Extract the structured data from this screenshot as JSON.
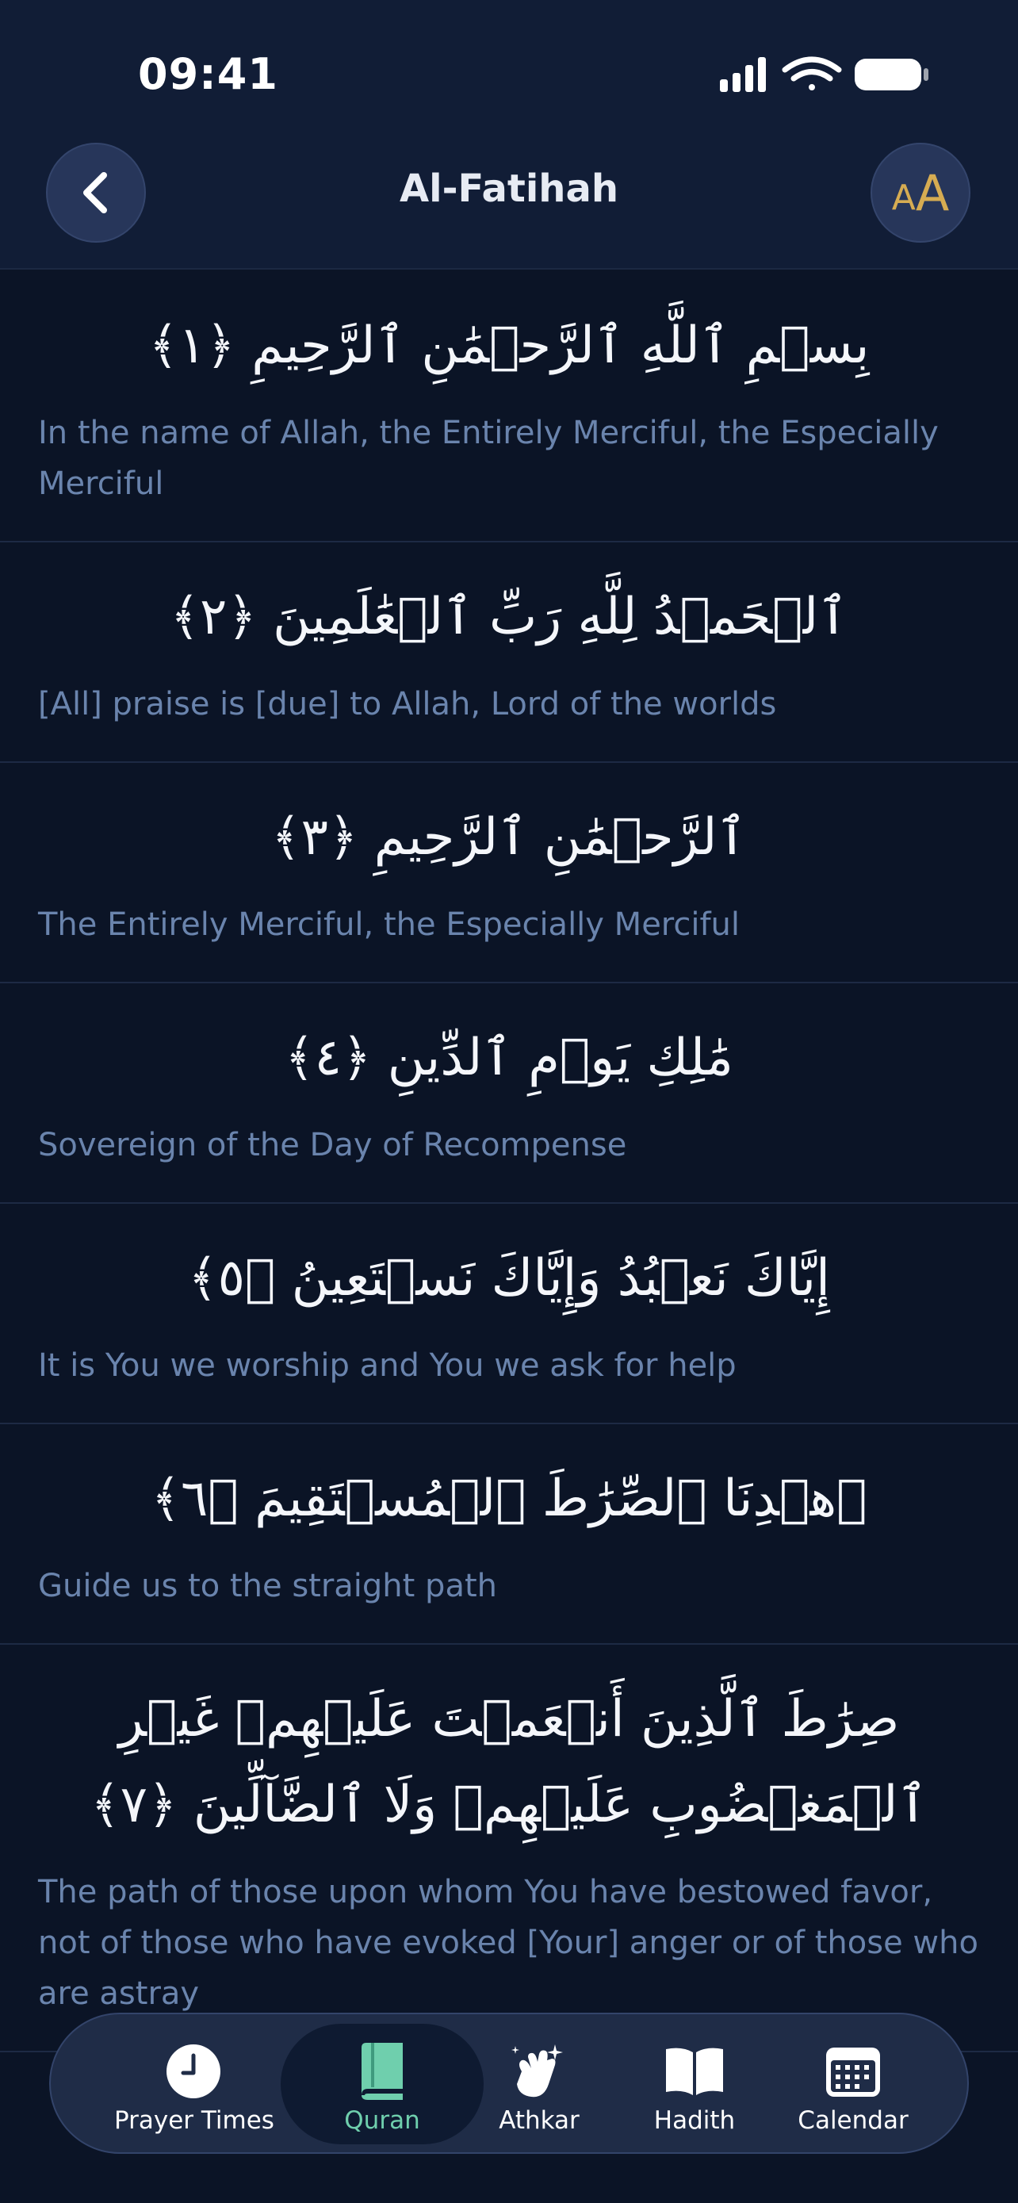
{
  "status_bar": {
    "time": "09:41"
  },
  "header": {
    "title": "Al-Fatihah",
    "font_button_small": "A",
    "font_button_big": "A"
  },
  "verses": [
    {
      "arabic": "بِسۡمِ ٱللَّهِ ٱلرَّحۡمَٰنِ ٱلرَّحِيمِ ﴿١﴾",
      "translation": "In the name of Allah, the Entirely Merciful, the Especially Merciful"
    },
    {
      "arabic": "ٱلۡحَمۡدُ لِلَّهِ رَبِّ ٱلۡعَٰلَمِينَ ﴿٢﴾",
      "translation": "[All] praise is [due] to Allah, Lord of the worlds"
    },
    {
      "arabic": "ٱلرَّحۡمَٰنِ ٱلرَّحِيمِ ﴿٣﴾",
      "translation": "The Entirely Merciful, the Especially Merciful"
    },
    {
      "arabic": "مَٰلِكِ يَوۡمِ ٱلدِّينِ ﴿٤﴾",
      "translation": "Sovereign of the Day of Recompense"
    },
    {
      "arabic": "إِيَّاكَ نَعۡبُدُ وَإِيَّاكَ نَسۡتَعِينُ ﴿٥﴾",
      "translation": "It is You we worship and You we ask for help"
    },
    {
      "arabic": "ٱهۡدِنَا ٱلصِّرَٰطَ ٱلۡمُسۡتَقِيمَ ﴿٦﴾",
      "translation": "Guide us to the straight path"
    },
    {
      "arabic": "صِرَٰطَ ٱلَّذِينَ أَنۡعَمۡتَ عَلَيۡهِمۡ غَيۡرِ ٱلۡمَغۡضُوبِ عَلَيۡهِمۡ وَلَا ٱلضَّآلِّينَ ﴿٧﴾",
      "translation": "The path of those upon whom You have bestowed favor, not of those who have evoked [Your] anger or of those who are astray"
    }
  ],
  "tabbar": {
    "tabs": [
      {
        "label": "Prayer Times",
        "icon": "clock-icon",
        "active": false
      },
      {
        "label": "Quran",
        "icon": "book-icon",
        "active": true
      },
      {
        "label": "Athkar",
        "icon": "hands-icon",
        "active": false
      },
      {
        "label": "Hadith",
        "icon": "open-book-icon",
        "active": false
      },
      {
        "label": "Calendar",
        "icon": "calendar-icon",
        "active": false
      }
    ]
  },
  "colors": {
    "background": "#0b1426",
    "header": "#111d36",
    "accent_gold": "#d6ac52",
    "accent_green": "#6fcfad",
    "translation_text": "#6a84ad"
  }
}
